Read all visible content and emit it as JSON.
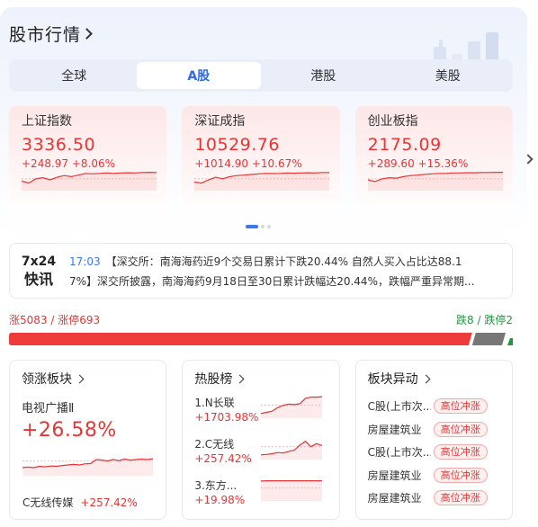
{
  "header": {
    "title": "股市行情"
  },
  "tabs": [
    {
      "label": "全球",
      "active": false
    },
    {
      "label": "A股",
      "active": true
    },
    {
      "label": "港股",
      "active": false
    },
    {
      "label": "美股",
      "active": false
    }
  ],
  "indices": [
    {
      "name": "上证指数",
      "value": "3336.50",
      "change": "+248.97",
      "pct": "+8.06%",
      "spark": [
        0.45,
        0.35,
        0.55,
        0.6,
        0.5,
        0.62,
        0.7,
        0.65,
        0.72,
        0.8,
        0.78,
        0.8,
        0.82,
        0.8,
        0.82,
        0.83,
        0.82,
        0.84,
        0.85,
        0.84
      ]
    },
    {
      "name": "深证成指",
      "value": "10529.76",
      "change": "+1014.90",
      "pct": "+10.67%",
      "spark": [
        0.4,
        0.35,
        0.5,
        0.62,
        0.55,
        0.65,
        0.7,
        0.72,
        0.75,
        0.78,
        0.8,
        0.79,
        0.8,
        0.82,
        0.81,
        0.82,
        0.83,
        0.82,
        0.84,
        0.84
      ]
    },
    {
      "name": "创业板指",
      "value": "2175.09",
      "change": "+289.60",
      "pct": "+15.36%",
      "spark": [
        0.5,
        0.42,
        0.55,
        0.6,
        0.58,
        0.65,
        0.7,
        0.72,
        0.76,
        0.78,
        0.8,
        0.8,
        0.82,
        0.82,
        0.83,
        0.83,
        0.84,
        0.84,
        0.85,
        0.85
      ]
    }
  ],
  "carousel": {
    "pages": 3,
    "active": 0
  },
  "news": {
    "badge_line1": "7x24",
    "badge_line2": "快讯",
    "time": "17:03",
    "text_line1": "【深交所：南海海药近9个交易日累计下跌20.44% 自然人买入占比达88.1",
    "text_line2": "7%】深交所披露，南海海药9月18日至30日累计跌幅达20.44%，跌幅严重异常期..."
  },
  "stats": {
    "left": "涨5083 / 涨停693",
    "right": "跌8 / 跌停2",
    "rise_count": 5083,
    "fall_count": 8,
    "colors": {
      "rise": "#f03b3b",
      "fall": "#777777",
      "limit_down": "#1e9a3d"
    }
  },
  "lead_sector": {
    "title": "领涨板块",
    "name": "电视广播Ⅱ",
    "pct": "+26.58%",
    "stock_name": "C无线传媒",
    "stock_pct": "+257.42%",
    "spark": [
      0.3,
      0.32,
      0.3,
      0.35,
      0.33,
      0.36,
      0.35,
      0.38,
      0.4,
      0.42,
      0.4,
      0.44,
      0.45,
      0.6,
      0.58,
      0.55,
      0.6,
      0.56,
      0.62,
      0.58,
      0.6,
      0.62,
      0.6,
      0.63
    ]
  },
  "hot_list": {
    "title": "热股榜",
    "items": [
      {
        "name": "1.N长联",
        "pct": "+1703.98%",
        "spark": [
          0.2,
          0.25,
          0.3,
          0.45,
          0.55,
          0.6,
          0.58,
          0.62,
          0.85,
          0.9,
          0.9,
          0.92
        ]
      },
      {
        "name": "2.C无线",
        "pct": "+257.42%",
        "spark": [
          0.2,
          0.22,
          0.25,
          0.3,
          0.28,
          0.35,
          0.4,
          0.62,
          0.78,
          0.55,
          0.68,
          0.6
        ]
      },
      {
        "name": "3.东方...",
        "pct": "+19.98%",
        "spark": [
          0.85,
          0.86,
          0.86,
          0.86,
          0.86,
          0.86,
          0.86,
          0.86,
          0.86,
          0.86,
          0.86,
          0.86
        ]
      }
    ]
  },
  "sector_moves": {
    "title": "板块异动",
    "items": [
      {
        "name": "C股(上市次...",
        "tag": "高位冲涨"
      },
      {
        "name": "房屋建筑业",
        "tag": "高位冲涨"
      },
      {
        "name": "C股(上市次...",
        "tag": "高位冲涨"
      },
      {
        "name": "房屋建筑业",
        "tag": "高位冲涨"
      },
      {
        "name": "房屋建筑业",
        "tag": "高位冲涨"
      }
    ]
  },
  "icons": [
    "chevron-right-icon",
    "bar-chart-deco-icon"
  ]
}
